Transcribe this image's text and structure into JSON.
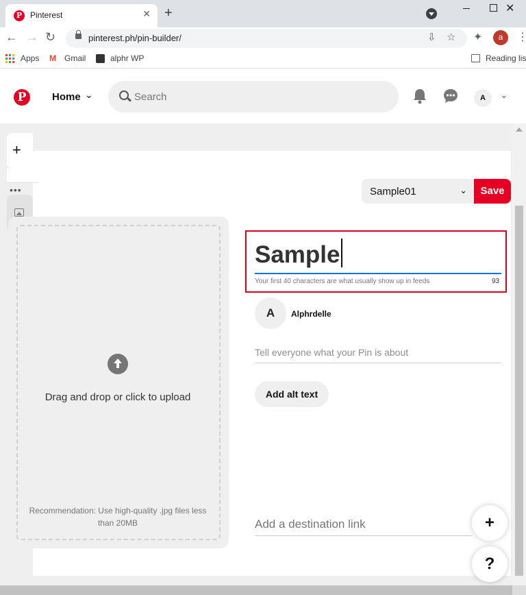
{
  "browser": {
    "tab_title": "Pinterest",
    "tab_favicon": "P",
    "new_tab_symbol": "+",
    "close_tab_symbol": "✕",
    "url": "pinterest.ph/pin-builder/",
    "profile_initial": "a",
    "bookmarks": {
      "apps": "Apps",
      "gmail": "Gmail",
      "alphr": "alphr WP",
      "reading_list": "Reading list"
    }
  },
  "header": {
    "logo": "P",
    "home_label": "Home",
    "search_placeholder": "Search",
    "avatar_initial": "A"
  },
  "builder": {
    "board_name": "Sample01",
    "save_label": "Save",
    "upload_text": "Drag and drop or click to upload",
    "upload_recommendation": "Recommendation: Use high-quality .jpg files less than 20MB",
    "title_value": "Sample",
    "title_hint": "Your first 40 characters are what usually show up in feeds",
    "title_remaining": "93",
    "author_initial": "A",
    "author_name": "Alphrdelle",
    "about_placeholder": "Tell everyone what your Pin is about",
    "alt_text_label": "Add alt text",
    "destination_placeholder": "Add a destination link"
  },
  "fabs": {
    "add": "+",
    "help": "?"
  },
  "colors": {
    "pinterest_red": "#e60023",
    "focus_blue": "#0074e8",
    "highlight_box": "#d4001c"
  }
}
